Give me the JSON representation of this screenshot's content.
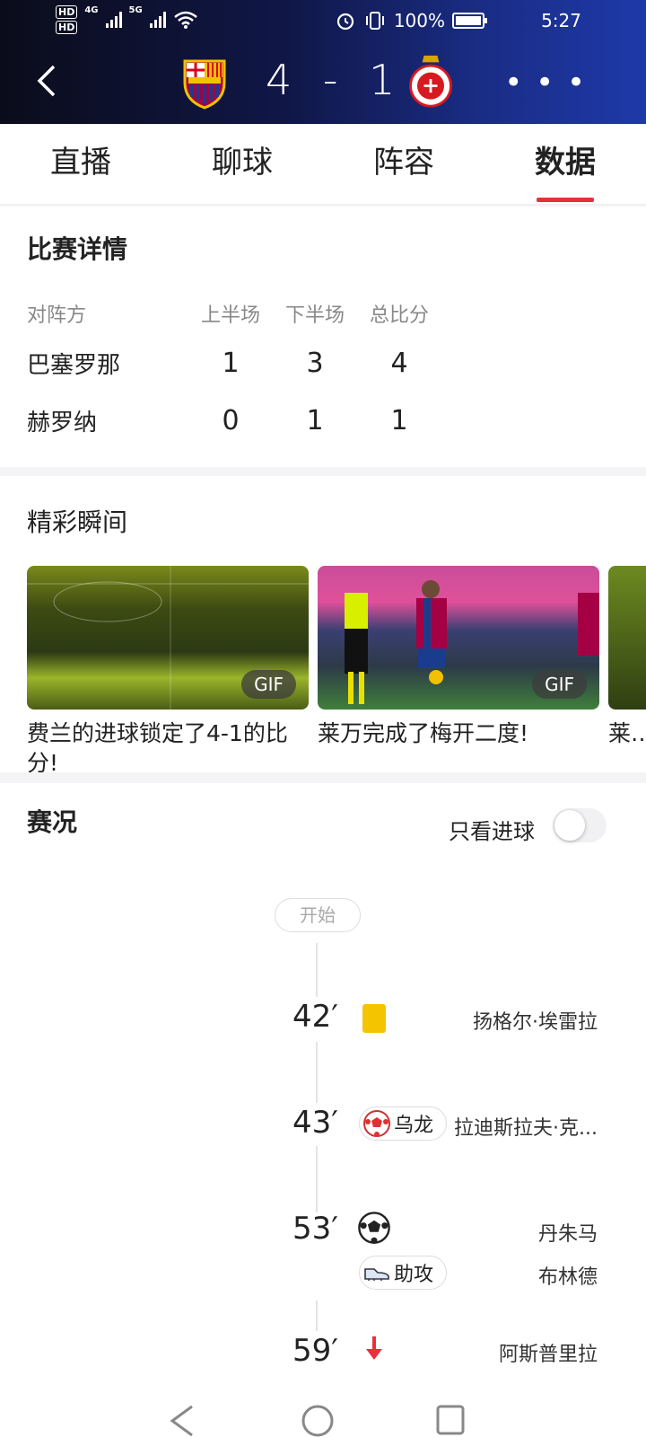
{
  "status_bar": {
    "hd1": "HD",
    "hd2": "HD",
    "net1": "4G",
    "net2": "5G",
    "battery": "100%",
    "time": "5:27"
  },
  "match": {
    "score": "4 - 1",
    "home_color": "#a50044",
    "away_color": "#d71920"
  },
  "tabs": [
    {
      "label": "直播"
    },
    {
      "label": "聊球"
    },
    {
      "label": "阵容"
    },
    {
      "label": "数据",
      "active": true
    }
  ],
  "details": {
    "title": "比赛详情",
    "headers": [
      "对阵方",
      "上半场",
      "下半场",
      "总比分"
    ],
    "rows": [
      {
        "team": "巴塞罗那",
        "h1": "1",
        "h2": "3",
        "total": "4"
      },
      {
        "team": "赫罗纳",
        "h1": "0",
        "h2": "1",
        "total": "1"
      }
    ]
  },
  "highlights": {
    "title": "精彩瞬间",
    "badge": "GIF",
    "items": [
      {
        "caption": "费兰的进球锁定了4-1的比分!"
      },
      {
        "caption": "莱万完成了梅开二度!"
      },
      {
        "caption": "莱…领"
      }
    ]
  },
  "timeline": {
    "title": "赛况",
    "toggle_label": "只看进球",
    "start": "开始",
    "events": [
      {
        "minute": "42′",
        "type": "yellow-card",
        "player": "扬格尔·埃雷拉"
      },
      {
        "minute": "43′",
        "type": "own-goal",
        "tag": "乌龙",
        "player": "拉迪斯拉夫·克..."
      },
      {
        "minute": "53′",
        "type": "goal",
        "player": "丹朱马",
        "assist_tag": "助攻",
        "assist_player": "布林德"
      },
      {
        "minute": "59′",
        "type": "sub-out",
        "player": "阿斯普里拉"
      }
    ]
  }
}
